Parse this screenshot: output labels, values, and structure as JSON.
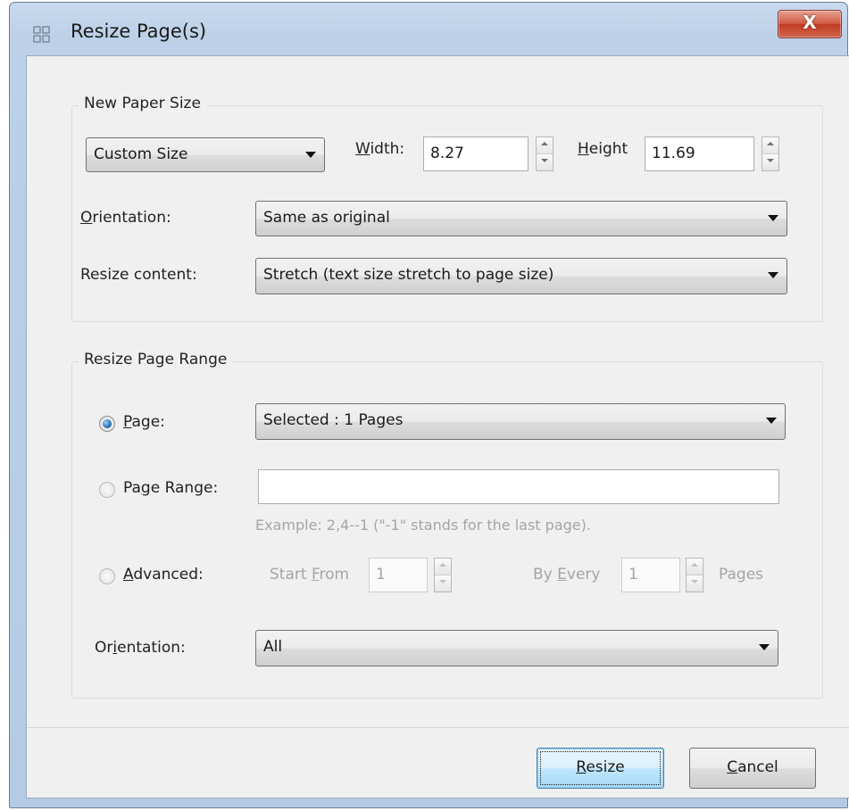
{
  "window": {
    "title": "Resize Page(s)",
    "close_label": "X",
    "icon": "resize-pages-icon"
  },
  "paper_size": {
    "group_title": "New Paper Size",
    "size_preset": "Custom Size",
    "width_label": "Width:",
    "width_value": "8.27",
    "height_label": "Height",
    "height_value": "11.69",
    "orientation_label": "Orientation:",
    "orientation_value": "Same as original",
    "resize_content_label": "Resize content:",
    "resize_content_value": "Stretch (text size stretch to page size)"
  },
  "page_range": {
    "group_title": "Resize Page Range",
    "page_label": "Page:",
    "page_selected": true,
    "page_value": "Selected : 1 Pages",
    "page_range_label": "Page Range:",
    "page_range_selected": false,
    "page_range_value": "",
    "example_text": "Example: 2,4--1 (\"-1\" stands for the last page).",
    "advanced_label": "Advanced:",
    "advanced_selected": false,
    "start_from_label": "Start From",
    "start_from_value": "1",
    "by_every_label": "By Every",
    "by_every_value": "1",
    "pages_label": "Pages",
    "orientation_label": "Orientation:",
    "orientation_value": "All"
  },
  "buttons": {
    "resize": "Resize",
    "cancel": "Cancel"
  }
}
